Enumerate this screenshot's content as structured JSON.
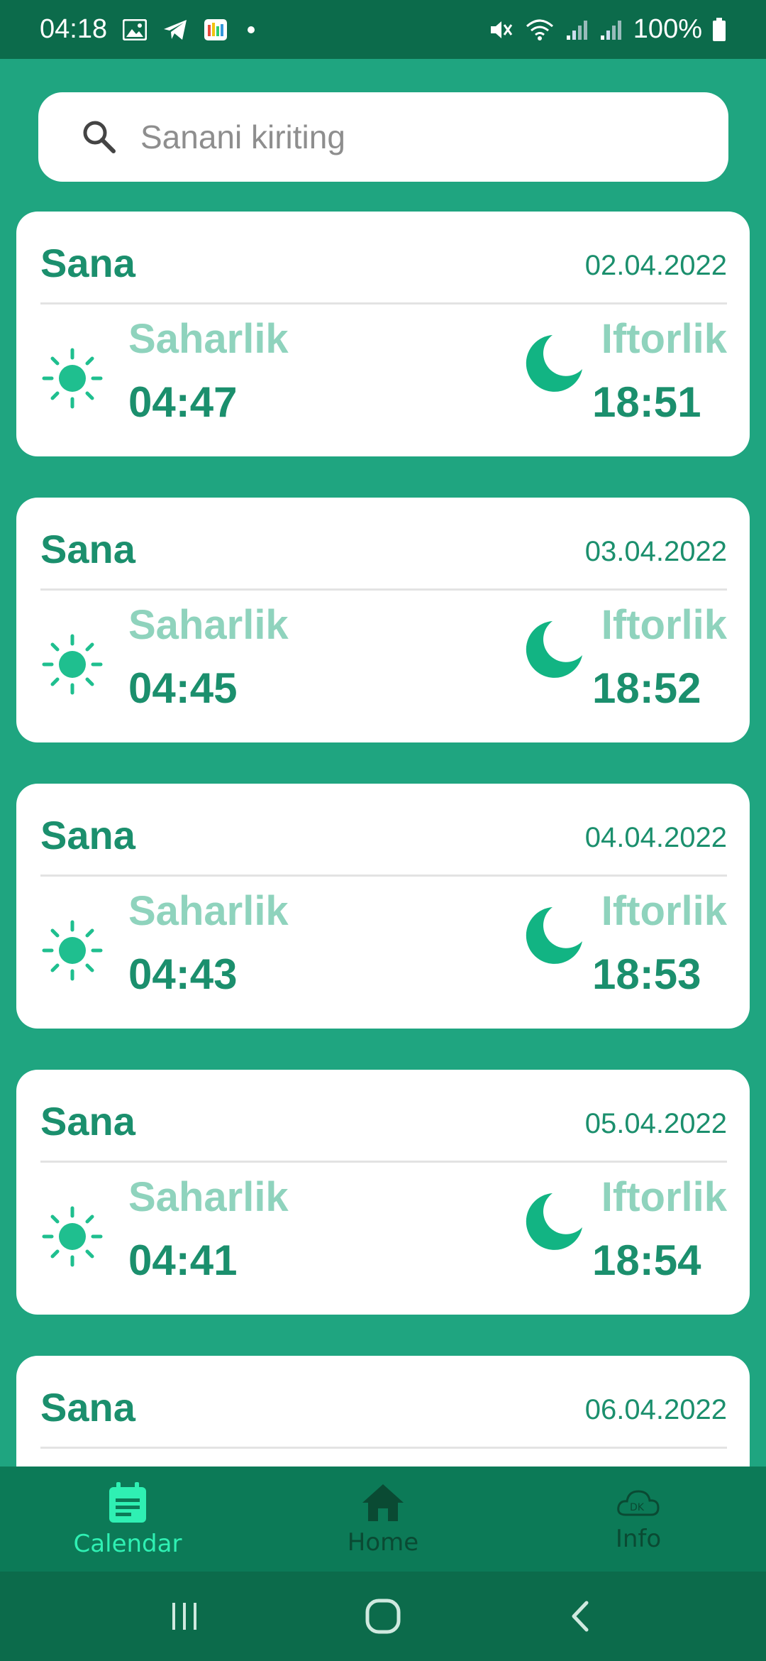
{
  "status_bar": {
    "time": "04:18",
    "battery": "100%",
    "icons": [
      "gallery-icon",
      "telegram-icon",
      "app-icon",
      "mute-icon",
      "wifi-icon",
      "signal-icon",
      "signal-icon",
      "battery-icon"
    ]
  },
  "search": {
    "placeholder": "Sanani kiriting",
    "value": ""
  },
  "labels": {
    "card_title": "Sana",
    "suhoor": "Saharlik",
    "iftar": "Iftorlik"
  },
  "schedule": [
    {
      "date": "02.04.2022",
      "suhoor_time": "04:47",
      "iftar_time": "18:51"
    },
    {
      "date": "03.04.2022",
      "suhoor_time": "04:45",
      "iftar_time": "18:52"
    },
    {
      "date": "04.04.2022",
      "suhoor_time": "04:43",
      "iftar_time": "18:53"
    },
    {
      "date": "05.04.2022",
      "suhoor_time": "04:41",
      "iftar_time": "18:54"
    },
    {
      "date": "06.04.2022",
      "suhoor_time": "",
      "iftar_time": ""
    }
  ],
  "bottom_nav": {
    "items": [
      {
        "label": "Calendar",
        "icon": "calendar-icon",
        "active": true
      },
      {
        "label": "Home",
        "icon": "home-icon",
        "active": false
      },
      {
        "label": "Info",
        "icon": "info-icon",
        "active": false
      }
    ]
  },
  "colors": {
    "background": "#1fa580",
    "status_bar": "#0c6b4b",
    "accent": "#1b8f6d",
    "accent_light": "#8fd3bd",
    "nav_active": "#2ff0b3"
  }
}
